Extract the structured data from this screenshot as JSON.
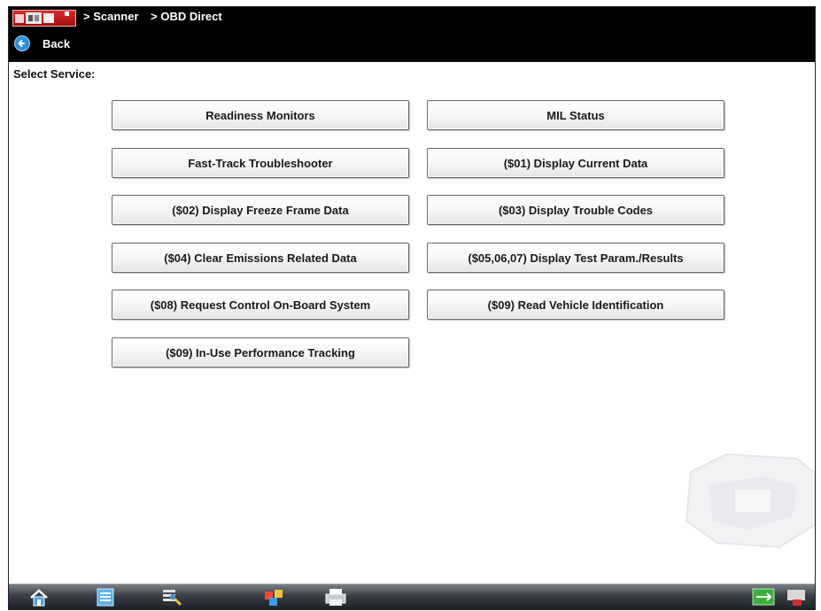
{
  "header": {
    "breadcrumb": [
      "> Scanner",
      "> OBD Direct"
    ],
    "back_label": "Back"
  },
  "main": {
    "select_label": "Select Service:",
    "services": [
      "Readiness Monitors",
      "MIL Status",
      "Fast-Track Troubleshooter",
      "($01) Display Current Data",
      "($02) Display Freeze Frame Data",
      "($03) Display Trouble Codes",
      "($04) Clear Emissions Related Data",
      "($05,06,07) Display Test Param./Results",
      "($08) Request Control On-Board System",
      "($09) Read Vehicle Identification",
      "($09) In-Use Performance Tracking"
    ]
  },
  "taskbar": {
    "icons": [
      "home-icon",
      "scanner-list-icon",
      "tools-icon",
      "data-viewer-icon",
      "print-icon",
      "connection-status-icon",
      "power-icon"
    ]
  },
  "colors": {
    "header_bg": "#000000",
    "logo_red": "#c41d1d",
    "back_blue": "#2f8fd8",
    "button_border": "#6a6a6a"
  }
}
